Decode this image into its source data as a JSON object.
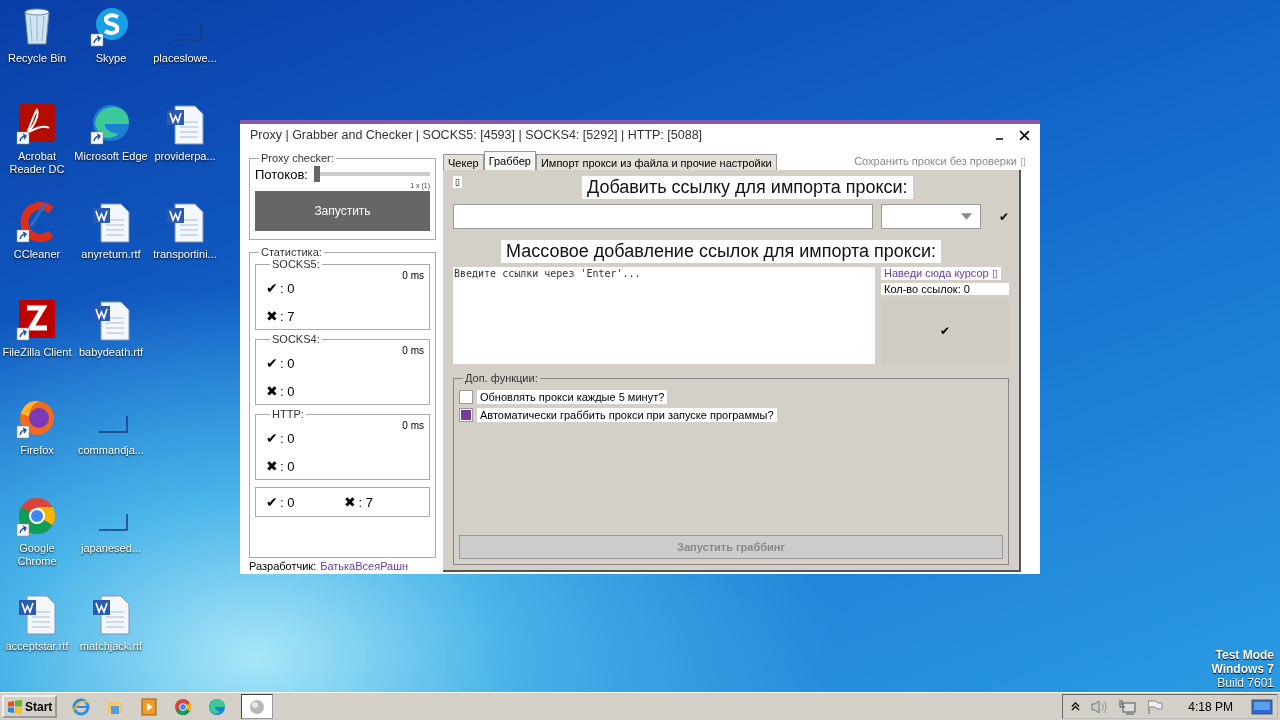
{
  "desktop": {
    "icons": [
      {
        "label": "Recycle Bin",
        "kind": "recycle",
        "shortcut": false
      },
      {
        "label": "Acrobat Reader DC",
        "kind": "acrobat",
        "shortcut": true
      },
      {
        "label": "CCleaner",
        "kind": "ccleaner",
        "shortcut": true
      },
      {
        "label": "FileZilla Client",
        "kind": "filezilla",
        "shortcut": true
      },
      {
        "label": "Firefox",
        "kind": "firefox",
        "shortcut": true
      },
      {
        "label": "Google Chrome",
        "kind": "chrome",
        "shortcut": true
      },
      {
        "label": "acceptstar.rtf",
        "kind": "word",
        "shortcut": false
      },
      {
        "label": "Skype",
        "kind": "skype",
        "shortcut": true
      },
      {
        "label": "Microsoft Edge",
        "kind": "edge",
        "shortcut": true
      },
      {
        "label": "anyreturn.rtf",
        "kind": "word",
        "shortcut": false
      },
      {
        "label": "babydeath.rtf",
        "kind": "word",
        "shortcut": false
      },
      {
        "label": "commandja...",
        "kind": "blank",
        "shortcut": false
      },
      {
        "label": "japanesed...",
        "kind": "blank",
        "shortcut": false
      },
      {
        "label": "matchjack.rtf",
        "kind": "word",
        "shortcut": false
      },
      {
        "label": "placeslowe...",
        "kind": "blank",
        "shortcut": false
      },
      {
        "label": "providerpa...",
        "kind": "word",
        "shortcut": false
      },
      {
        "label": "transportini...",
        "kind": "word",
        "shortcut": false
      }
    ],
    "system_notice": [
      "Test Mode",
      "Windows 7",
      "Build 7601"
    ]
  },
  "window": {
    "title": "Proxy | Grabber and Checker | SOCKS5: [4593] | SOCKS4: [5292] | HTTP: [5088]",
    "checker": {
      "legend": "Proxy checker:",
      "threads_label": "Потоков:",
      "threads": {
        "level": 0
      },
      "threads_value": "1 x (1)",
      "start_button": "Запустить"
    },
    "stats": {
      "legend": "Статистика:",
      "groups": [
        {
          "name": "SOCKS5:",
          "time": "0 ms",
          "good_mark": "✔",
          "good": ": 0",
          "bad_mark": "✖",
          "bad": ": 7"
        },
        {
          "name": "SOCKS4:",
          "time": "0 ms",
          "good_mark": "✔",
          "good": ": 0",
          "bad_mark": "✖",
          "bad": ": 0"
        },
        {
          "name": "HTTP:",
          "time": "0 ms",
          "good_mark": "✔",
          "good": ": 0",
          "bad_mark": "✖",
          "bad": ": 0"
        }
      ],
      "totals": {
        "good_mark": "✔",
        "good": ": 0",
        "bad_mark": "✖",
        "bad": ": 7"
      }
    },
    "developer_label": "Разработчик:",
    "developer_name": "БатькаВсеяРашн",
    "tabs": [
      {
        "label": "Чекер",
        "selected": false
      },
      {
        "label": "Граббер",
        "selected": true
      },
      {
        "label": "Импорт прокси из файла и прочие настройки",
        "selected": false
      }
    ],
    "save_without_check": "Сохранить прокси без проверки ▯",
    "grabber": {
      "corner_box": "▯",
      "heading_single": "Добавить ссылку для импорта прокси:",
      "add_mark": "✔",
      "heading_mass": "Массовое добавление ссылок для импорта прокси:",
      "links_placeholder": "Введите ссылки через 'Enter'...",
      "hover_hint": "Наведи сюда курсор ▯",
      "links_count": "Кол-во ссылок: 0",
      "mass_add_mark": "✔",
      "extra_legend": "Доп. функции:",
      "options": [
        {
          "label": "Обновлять прокси каждые 5 минут?",
          "checked": false
        },
        {
          "label": "Автоматически граббить прокси при запуске программы?",
          "checked": true
        }
      ],
      "grab_button": {
        "label": "Запустить граббинг",
        "disabled": true
      }
    }
  },
  "taskbar": {
    "start": "Start",
    "apps": [
      {
        "kind": "ie",
        "active": false
      },
      {
        "kind": "explorer",
        "active": false
      },
      {
        "kind": "media",
        "active": false
      },
      {
        "kind": "chrome",
        "active": false
      },
      {
        "kind": "edge",
        "active": false
      },
      {
        "kind": "globe",
        "active": true
      }
    ],
    "clock": "4:18 PM"
  }
}
